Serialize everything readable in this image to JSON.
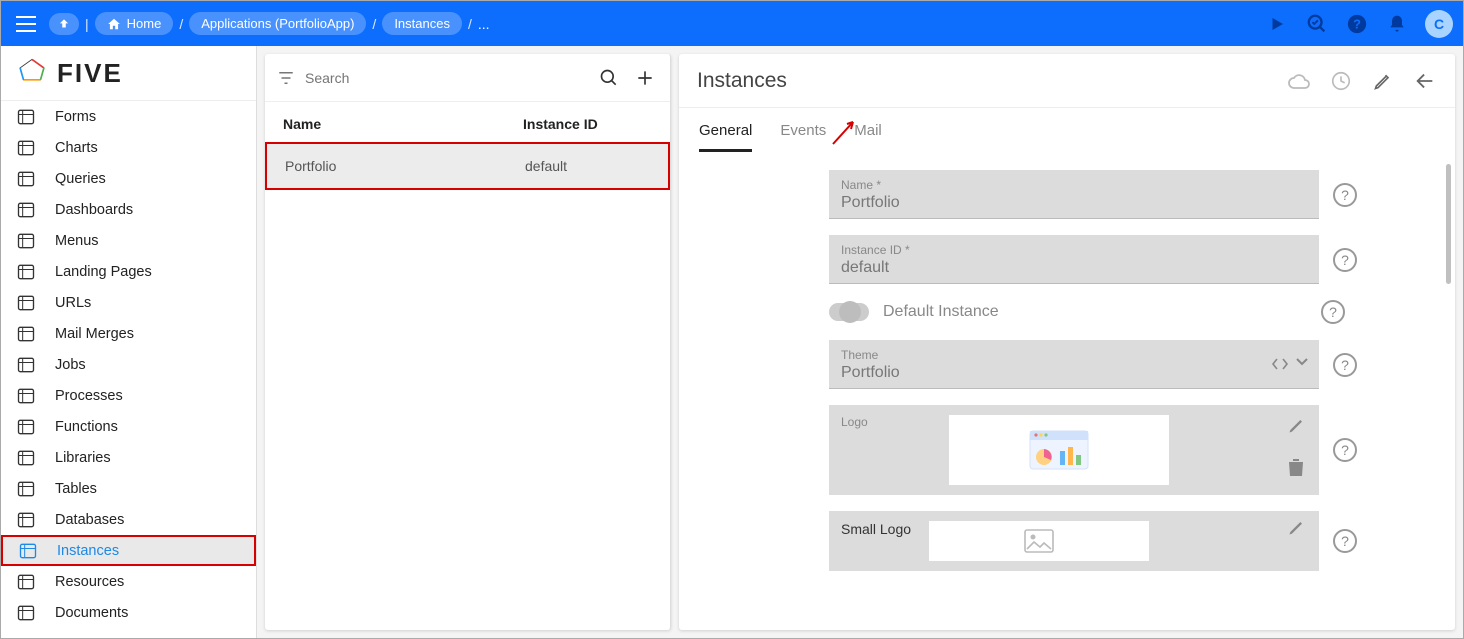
{
  "topbar": {
    "breadcrumbs": [
      "Home",
      "Applications (PortfolioApp)",
      "Instances",
      "..."
    ],
    "avatar_letter": "C"
  },
  "sidebar": {
    "logo_text": "FIVE",
    "items": [
      {
        "label": "Forms"
      },
      {
        "label": "Charts"
      },
      {
        "label": "Queries"
      },
      {
        "label": "Dashboards"
      },
      {
        "label": "Menus"
      },
      {
        "label": "Landing Pages"
      },
      {
        "label": "URLs"
      },
      {
        "label": "Mail Merges"
      },
      {
        "label": "Jobs"
      },
      {
        "label": "Processes"
      },
      {
        "label": "Functions"
      },
      {
        "label": "Libraries"
      },
      {
        "label": "Tables"
      },
      {
        "label": "Databases"
      },
      {
        "label": "Instances"
      },
      {
        "label": "Resources"
      },
      {
        "label": "Documents"
      }
    ],
    "active_index": 14
  },
  "midpanel": {
    "search_placeholder": "Search",
    "columns": [
      "Name",
      "Instance ID"
    ],
    "rows": [
      {
        "name": "Portfolio",
        "instance_id": "default"
      }
    ]
  },
  "detail": {
    "title": "Instances",
    "tabs": [
      "General",
      "Events",
      "Mail"
    ],
    "active_tab": 0,
    "fields": {
      "name_label": "Name *",
      "name_value": "Portfolio",
      "instanceid_label": "Instance ID *",
      "instanceid_value": "default",
      "default_instance_label": "Default Instance",
      "theme_label": "Theme",
      "theme_value": "Portfolio",
      "logo_label": "Logo",
      "small_logo_label": "Small Logo"
    }
  }
}
